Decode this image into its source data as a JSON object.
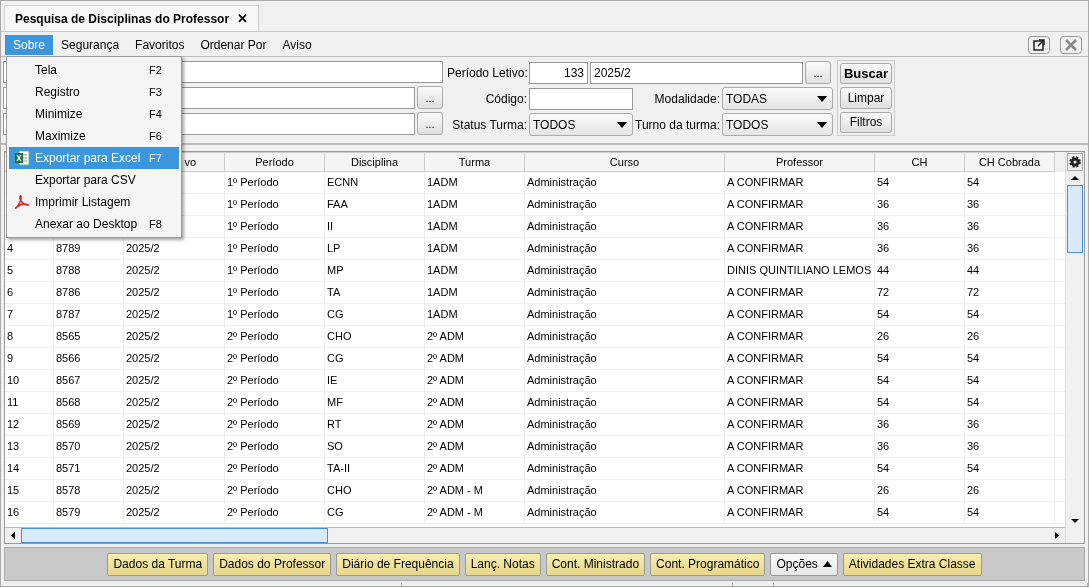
{
  "tab": {
    "title": "Pesquisa de Disciplinas do Professor",
    "close": "✕"
  },
  "menu_bar": [
    {
      "label": "Sobre",
      "selected": true
    },
    {
      "label": "Segurança",
      "selected": false
    },
    {
      "label": "Favoritos",
      "selected": false
    },
    {
      "label": "Ordenar Por",
      "selected": false
    },
    {
      "label": "Aviso",
      "selected": false
    }
  ],
  "menu": [
    {
      "label": "Tela",
      "shortcut": "F2",
      "selected": false
    },
    {
      "label": "Registro",
      "shortcut": "F3",
      "selected": false
    },
    {
      "label": "Minimize",
      "shortcut": "F4",
      "selected": false
    },
    {
      "label": "Maximize",
      "shortcut": "F6",
      "selected": false
    },
    {
      "label": "Exportar para Excel",
      "shortcut": "F7",
      "selected": true
    },
    {
      "label": "Exportar para CSV",
      "selected": false
    },
    {
      "label": "Imprimir Listagem",
      "selected": false
    },
    {
      "label": "Anexar ao Desktop",
      "shortcut": "F8",
      "selected": false
    }
  ],
  "filters": {
    "periodo_letivo": {
      "label": "Período Letivo:",
      "code": "133",
      "value": "2025/2",
      "browse": "..."
    },
    "browse_buttons": [
      "...",
      "..."
    ],
    "codigo": {
      "label": "Código:"
    },
    "modalidade": {
      "label": "Modalidade:",
      "value": "TODAS"
    },
    "status_turma": {
      "label": "Status Turma:",
      "value": "TODOS"
    },
    "turno": {
      "label": "Turno da turma:",
      "value": "TODOS"
    },
    "buttons": [
      "Buscar",
      "Limpar",
      "Filtros"
    ]
  },
  "table": {
    "columns": [
      {},
      {},
      {
        "label": "vo"
      },
      {
        "label": "Período"
      },
      {
        "label": "Disciplina"
      },
      {
        "label": "Turma"
      },
      {
        "label": "Curso"
      },
      {
        "label": "Professor"
      },
      {
        "label": "CH"
      },
      {
        "label": "CH Cobrada"
      }
    ],
    "rows": [
      [
        null,
        null,
        null,
        "1º Período",
        "ECNN",
        "1ADM",
        "Administração",
        "A CONFIRMAR",
        "54",
        "54"
      ],
      [
        null,
        null,
        null,
        "1º Período",
        "FAA",
        "1ADM",
        "Administração",
        "A CONFIRMAR",
        "36",
        "36"
      ],
      [
        null,
        null,
        null,
        "1º Período",
        "II",
        "1ADM",
        "Administração",
        "A CONFIRMAR",
        "36",
        "36"
      ],
      [
        "4",
        "8789",
        "2025/2",
        "1º Período",
        "LP",
        "1ADM",
        "Administração",
        "A CONFIRMAR",
        "36",
        "36"
      ],
      [
        "5",
        "8788",
        "2025/2",
        "1º Período",
        "MP",
        "1ADM",
        "Administração",
        "DINIS QUINTILIANO LEMOS",
        "44",
        "44"
      ],
      [
        "6",
        "8786",
        "2025/2",
        "1º Período",
        "TA",
        "1ADM",
        "Administração",
        "A CONFIRMAR",
        "72",
        "72"
      ],
      [
        "7",
        "8787",
        "2025/2",
        "1º Período",
        "CG",
        "1ADM",
        "Administração",
        "A CONFIRMAR",
        "54",
        "54"
      ],
      [
        "8",
        "8565",
        "2025/2",
        "2º Período",
        "CHO",
        "2º ADM",
        "Administração",
        "A CONFIRMAR",
        "26",
        "26"
      ],
      [
        "9",
        "8566",
        "2025/2",
        "2º Período",
        "CG",
        "2º ADM",
        "Administração",
        "A CONFIRMAR",
        "54",
        "54"
      ],
      [
        "10",
        "8567",
        "2025/2",
        "2º Período",
        "IE",
        "2º ADM",
        "Administração",
        "A CONFIRMAR",
        "54",
        "54"
      ],
      [
        "11",
        "8568",
        "2025/2",
        "2º Período",
        "MF",
        "2º ADM",
        "Administração",
        "A CONFIRMAR",
        "54",
        "54"
      ],
      [
        "12",
        "8569",
        "2025/2",
        "2º Período",
        "RT",
        "2º ADM",
        "Administração",
        "A CONFIRMAR",
        "36",
        "36"
      ],
      [
        "13",
        "8570",
        "2025/2",
        "2º Período",
        "SO",
        "2º ADM",
        "Administração",
        "A CONFIRMAR",
        "36",
        "36"
      ],
      [
        "14",
        "8571",
        "2025/2",
        "2º Período",
        "TA-II",
        "2º ADM",
        "Administração",
        "A CONFIRMAR",
        "54",
        "54"
      ],
      [
        "15",
        "8578",
        "2025/2",
        "2º Período",
        "CHO",
        "2º ADM - M",
        "Administração",
        "A CONFIRMAR",
        "26",
        "26"
      ],
      [
        "16",
        "8579",
        "2025/2",
        "2º Período",
        "CG",
        "2º ADM - M",
        "Administração",
        "A CONFIRMAR",
        "54",
        "54"
      ]
    ]
  },
  "bottom_buttons": [
    {
      "label": "Dados da Turma",
      "kind": "action"
    },
    {
      "label": "Dados do Professor",
      "kind": "action"
    },
    {
      "label": "Diário de Frequência",
      "kind": "action"
    },
    {
      "label": "Lanç. Notas",
      "kind": "action"
    },
    {
      "label": "Cont. Ministrado",
      "kind": "action"
    },
    {
      "label": "Cont. Programático",
      "kind": "action"
    },
    {
      "label": "Opções",
      "kind": "dropdown"
    },
    {
      "label": "Atividades Extra Classe",
      "kind": "action"
    }
  ]
}
